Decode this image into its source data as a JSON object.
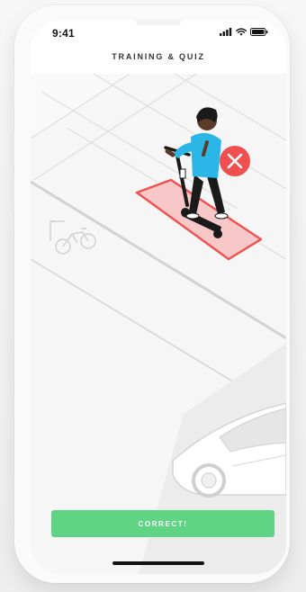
{
  "status_bar": {
    "time": "9:41",
    "icons": [
      "signal-icon",
      "wifi-icon",
      "battery-icon"
    ]
  },
  "header": {
    "title": "TRAINING & QUIZ"
  },
  "scene": {
    "illustration": "rider-on-scooter-in-bike-lane",
    "result_marker": "close-icon",
    "colors": {
      "incorrect": "#f04f4f",
      "zone_fill": "#f8c8c8",
      "rider_shirt": "#2ab6e6",
      "rider_pants": "#1a1a1a",
      "road": "#f6f6f6"
    }
  },
  "action": {
    "label": "CORRECT!",
    "color": "#5fd484"
  }
}
